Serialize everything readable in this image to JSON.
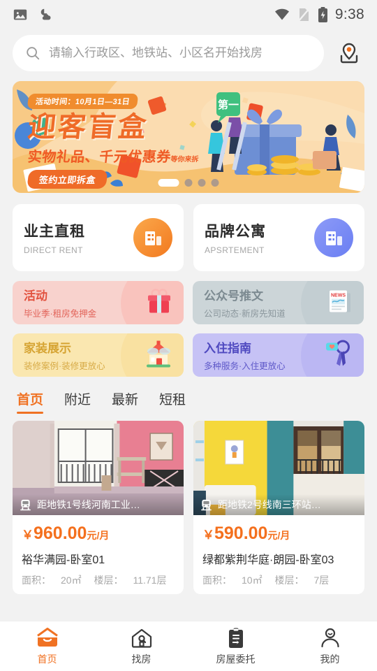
{
  "status_bar": {
    "time": "9:38",
    "left_icons": [
      "image-icon",
      "weather-icon"
    ],
    "right_icons": [
      "wifi-icon",
      "sim-off-icon",
      "battery-charging-icon"
    ]
  },
  "search": {
    "placeholder": "请输入行政区、地铁站、小区名开始找房",
    "value": "",
    "icon": "search-icon",
    "location_icon": "map-pin-icon"
  },
  "banner": {
    "pill": "活动时间：10月1日—31日",
    "title": "迎客盲盒",
    "subtitle": "实物礼品、千元优惠券",
    "subtitle_small": "等你来拆",
    "button": "签约立即拆盒",
    "dots_total": 4,
    "dot_active_index": 0
  },
  "category_cards": [
    {
      "title": "业主直租",
      "subtitle": "DIRECT RENT",
      "icon": "building-icon",
      "color": "#f2791f"
    },
    {
      "title": "品牌公寓",
      "subtitle": "APSRTEMENT",
      "icon": "building-icon",
      "color": "#6a7ef2"
    }
  ],
  "promo_tiles": [
    {
      "title": "活动",
      "subtitle": "毕业季·租房免押金",
      "icon": "gift-icon",
      "bg": "#f8d2cd",
      "fg": "#e2523f"
    },
    {
      "title": "公众号推文",
      "subtitle": "公司动态·新房先知道",
      "icon": "news-icon",
      "bg": "#ccd5d8",
      "fg": "#7c8a91"
    },
    {
      "title": "家装展示",
      "subtitle": "装修案例·装修更放心",
      "icon": "house-icon",
      "bg": "#fae7b0",
      "fg": "#d6a433"
    },
    {
      "title": "入住指南",
      "subtitle": "多种服务·入住更放心",
      "icon": "keys-icon",
      "bg": "#c6c2f5",
      "fg": "#5b55c9"
    }
  ],
  "tabs": [
    {
      "label": "首页",
      "active": true
    },
    {
      "label": "附近",
      "active": false
    },
    {
      "label": "最新",
      "active": false
    },
    {
      "label": "短租",
      "active": false
    }
  ],
  "listings": [
    {
      "subway_tag": "距地铁1号线河南工业…",
      "subway_icon": "subway-icon",
      "currency": "￥",
      "price": "960.00",
      "unit": "元/月",
      "name": "裕华满园-卧室01",
      "area_label": "面积：",
      "area_value": "20㎡",
      "floor_label": "楼层：",
      "floor_value": "11.71层"
    },
    {
      "subway_tag": "距地铁2号线南三环站…",
      "subway_icon": "subway-icon",
      "currency": "￥",
      "price": "590.00",
      "unit": "元/月",
      "name": "绿都紫荆华庭·朗园-卧室03",
      "area_label": "面积：",
      "area_value": "10㎡",
      "floor_label": "楼层：",
      "floor_value": "7层"
    }
  ],
  "bottom_nav": [
    {
      "label": "首页",
      "icon": "home-icon",
      "active": true
    },
    {
      "label": "找房",
      "icon": "house-search-icon",
      "active": false
    },
    {
      "label": "房屋委托",
      "icon": "clipboard-icon",
      "active": false
    },
    {
      "label": "我的",
      "icon": "user-icon",
      "active": false
    }
  ],
  "theme": {
    "accent": "#f07223",
    "price": "#f4701e",
    "page_bg": "#f2f2f2"
  }
}
